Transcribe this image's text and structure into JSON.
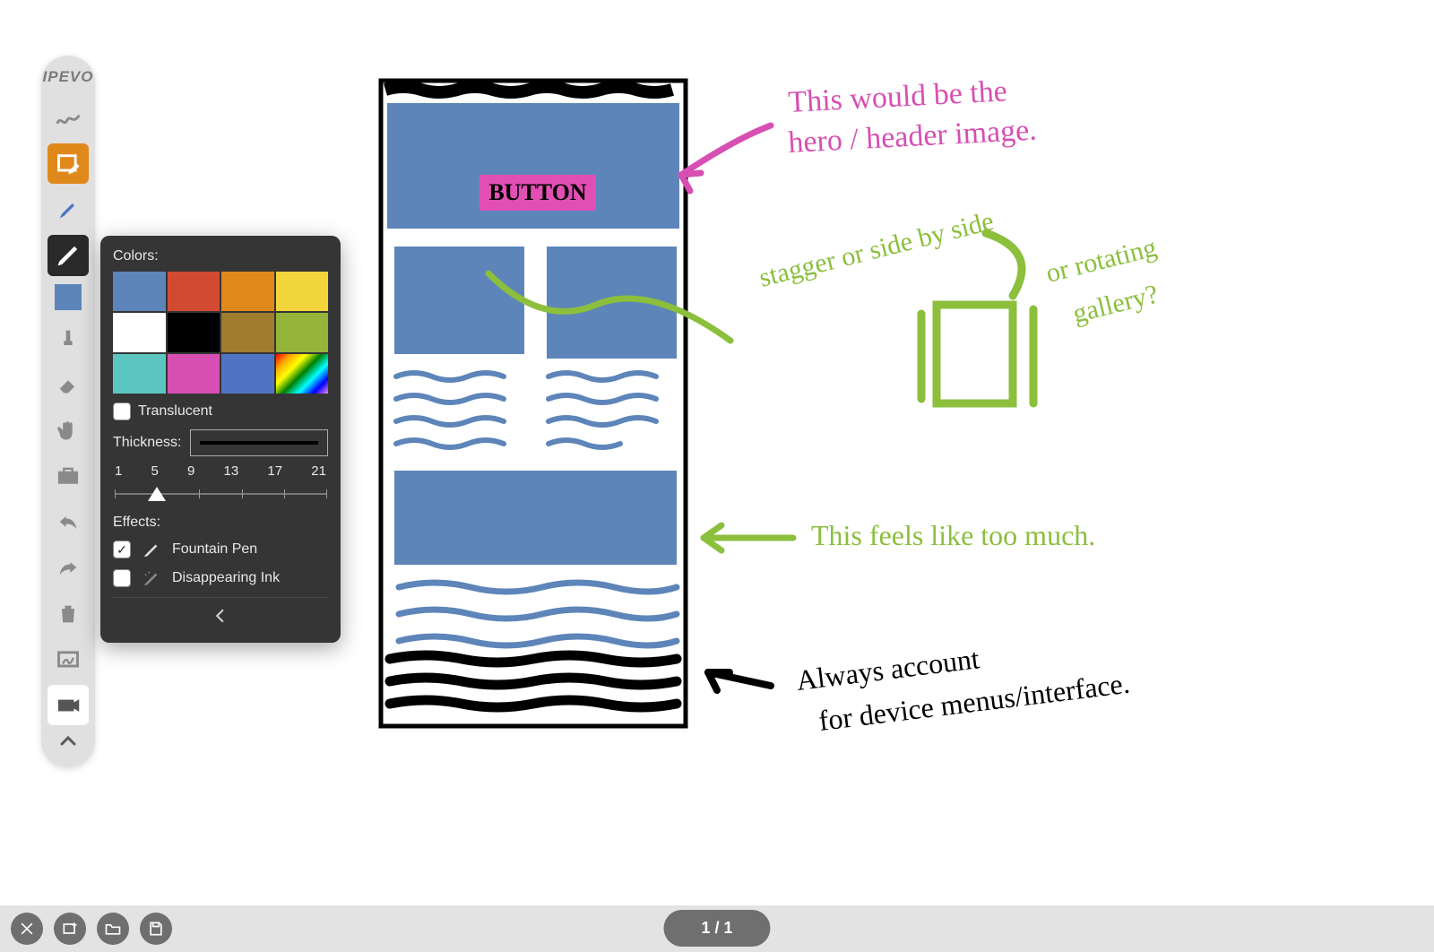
{
  "app": {
    "brand": "IPEVO"
  },
  "toolbar": {
    "items": [
      {
        "name": "freehand"
      },
      {
        "name": "shape",
        "active": "orange"
      },
      {
        "name": "highlighter"
      },
      {
        "name": "pen",
        "active": "dark"
      },
      {
        "name": "color-swatch"
      },
      {
        "name": "stamp"
      },
      {
        "name": "eraser"
      },
      {
        "name": "hand"
      },
      {
        "name": "toolbox"
      },
      {
        "name": "undo"
      },
      {
        "name": "redo"
      },
      {
        "name": "trash"
      },
      {
        "name": "board"
      },
      {
        "name": "camera"
      }
    ]
  },
  "pen_panel": {
    "colors_label": "Colors:",
    "palette": [
      "#5d85b9",
      "#d24a32",
      "#e0891b",
      "#f2d53b",
      "#ffffff",
      "#000000",
      "#a07c2f",
      "#94b43a",
      "#5bc6bf",
      "#d74fb2",
      "#4f74c3",
      "rainbow"
    ],
    "translucent_label": "Translucent",
    "translucent_checked": false,
    "thickness_label": "Thickness:",
    "thickness_ticks": [
      "1",
      "5",
      "9",
      "13",
      "17",
      "21"
    ],
    "thickness_value": 5,
    "effects_label": "Effects:",
    "effects": [
      {
        "label": "Fountain Pen",
        "checked": true,
        "icon": "fountain-pen"
      },
      {
        "label": "Disappearing Ink",
        "checked": false,
        "icon": "disappearing-ink"
      }
    ]
  },
  "bottom": {
    "page_indicator": "1 / 1",
    "buttons": [
      "close",
      "new-board",
      "open",
      "save"
    ]
  },
  "sketch": {
    "wireframe_button_text": "BUTTON",
    "annotations": {
      "pink": "This would be the hero / header image.",
      "green1": "stagger or side by side",
      "green2": "or rotating gallery?",
      "green3": "This feels like too much.",
      "black": "Always account for device menus/interface."
    },
    "colors": {
      "blue": "#5d85b9",
      "pink": "#d74fb2",
      "green": "#8bbf3c",
      "black": "#000000",
      "magentaFill": "#e24fb4"
    }
  }
}
